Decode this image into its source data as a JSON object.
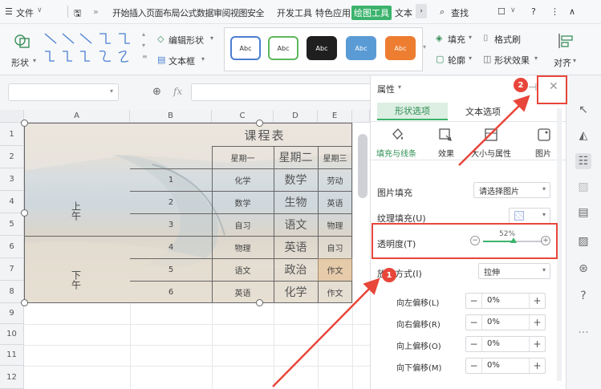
{
  "menubar": {
    "file_label": "文件",
    "tabs_text": "开始插入页面布局公式数据审阅视图安全",
    "dev_tools": "开发工具",
    "special": "特色应用",
    "active_tab": "绘图工具",
    "text_tab": "文本",
    "search": "查找"
  },
  "ribbon": {
    "shape_label": "形状",
    "edit_shape": "编辑形状",
    "text_box": "文本框",
    "style_swatches": [
      {
        "label": "Abc",
        "bg": "#ffffff",
        "fg": "#333333",
        "border": "#4a7fd0"
      },
      {
        "label": "Abc",
        "bg": "#ffffff",
        "fg": "#333333",
        "border": "#5cb85c"
      },
      {
        "label": "Abc",
        "bg": "#1f1f1f",
        "fg": "#ffffff",
        "border": "#1f1f1f"
      },
      {
        "label": "Abc",
        "bg": "#5b9bd5",
        "fg": "#ffffff",
        "border": "#5b9bd5"
      },
      {
        "label": "Abc",
        "bg": "#ed7d31",
        "fg": "#ffffff",
        "border": "#ed7d31"
      }
    ],
    "fill": "填充",
    "format_brush": "格式刷",
    "outline": "轮廓",
    "shape_effect": "形状效果",
    "align": "对齐"
  },
  "formula": {
    "fx": "fx"
  },
  "sheet": {
    "columns": [
      "A",
      "B",
      "C",
      "D",
      "E"
    ],
    "rows": [
      "1",
      "2",
      "3",
      "4",
      "5",
      "6",
      "7",
      "8",
      "9",
      "10",
      "11",
      "12"
    ],
    "table": {
      "title": "课程表",
      "header": [
        "星期一",
        "星期二",
        "星期三"
      ],
      "numbers": [
        "1",
        "2",
        "3",
        "4",
        "5",
        "6"
      ],
      "col_c": [
        "化学",
        "数学",
        "自习",
        "物理",
        "语文",
        "英语"
      ],
      "col_d": [
        "数学",
        "生物",
        "语文",
        "英语",
        "政治",
        "化学"
      ],
      "col_e": [
        "劳动",
        "英语",
        "物理",
        "自习",
        "作文",
        "作文"
      ],
      "morning": "上午",
      "afternoon": "下午"
    }
  },
  "panel": {
    "title": "属性",
    "tab_shape": "形状选项",
    "tab_text": "文本选项",
    "sub_fill": "填充与线条",
    "sub_effect": "效果",
    "sub_size": "大小与属性",
    "sub_picture": "图片",
    "pic_fill_label": "图片填充",
    "pic_fill_value": "请选择图片",
    "texture_label": "纹理填充(U)",
    "transparency_label": "透明度(T)",
    "transparency_value": "52%",
    "transparency_level": 0.52,
    "placement_label": "放置方式(I)",
    "placement_value": "拉伸",
    "offset_left_label": "向左偏移(L)",
    "offset_right_label": "向右偏移(R)",
    "offset_up_label": "向上偏移(O)",
    "offset_down_label": "向下偏移(M)",
    "offset_value": "0%"
  },
  "annotations": {
    "badge_1": "1",
    "badge_2": "2",
    "highlight_color": "#e8463a"
  }
}
